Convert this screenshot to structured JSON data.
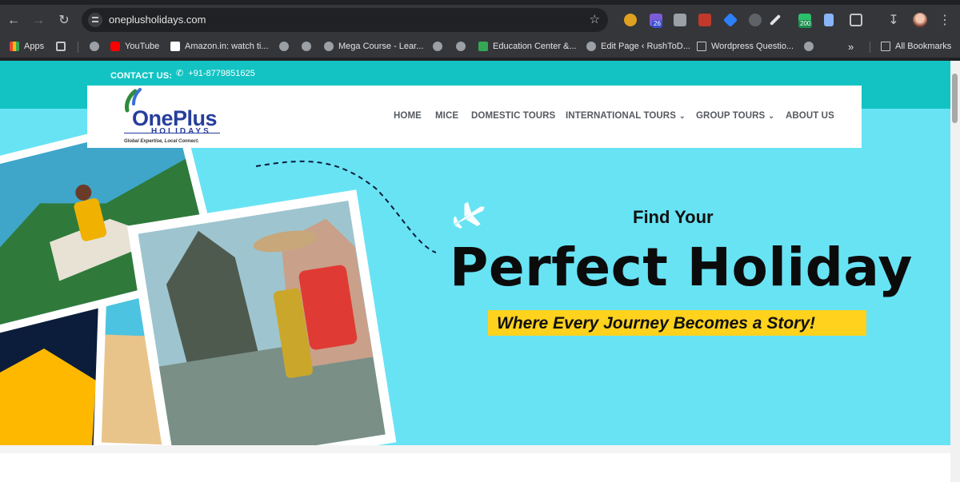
{
  "browser": {
    "url": "oneplusholidays.com",
    "extension_badges": {
      "calendar": "26",
      "counter": "200"
    },
    "bookmarks": [
      {
        "label": "Apps",
        "icon": "apps-grid-icon"
      },
      {
        "label": "YouTube",
        "icon": "youtube-icon"
      },
      {
        "label": "Amazon.in: watch ti...",
        "icon": "amazon-icon"
      },
      {
        "label": "Mega Course - Lear...",
        "icon": "globe-icon"
      },
      {
        "label": "Education Center &...",
        "icon": "education-icon"
      },
      {
        "label": "Edit Page ‹ RushToD...",
        "icon": "globe-icon"
      },
      {
        "label": "Wordpress Questio...",
        "icon": "folder-icon"
      },
      {
        "label": "All Bookmarks",
        "icon": "folder-icon"
      }
    ],
    "more_bookmarks": "»"
  },
  "site": {
    "contact_label": "CONTACT US:",
    "phone": "+91-8779851625",
    "logo": {
      "word": "OnePlus",
      "sub": "HOLIDAYS",
      "tagline": "Global Expertise, Local Connect."
    },
    "nav": [
      {
        "label": "HOME",
        "dropdown": false
      },
      {
        "label": "MICE",
        "dropdown": false
      },
      {
        "label": "DOMESTIC TOURS",
        "dropdown": false
      },
      {
        "label": "INTERNATIONAL TOURS",
        "dropdown": true
      },
      {
        "label": "GROUP TOURS",
        "dropdown": true
      },
      {
        "label": "ABOUT US",
        "dropdown": false
      }
    ],
    "hero": {
      "kicker": "Find Your",
      "headline": "Perfect Holiday",
      "tagline": "Where Every Journey Becomes a Story!"
    },
    "colors": {
      "teal": "#13c3c3",
      "hero_bg": "#68e3f4",
      "brand_blue": "#263e9c",
      "accent_yellow": "#ffd21e"
    }
  }
}
